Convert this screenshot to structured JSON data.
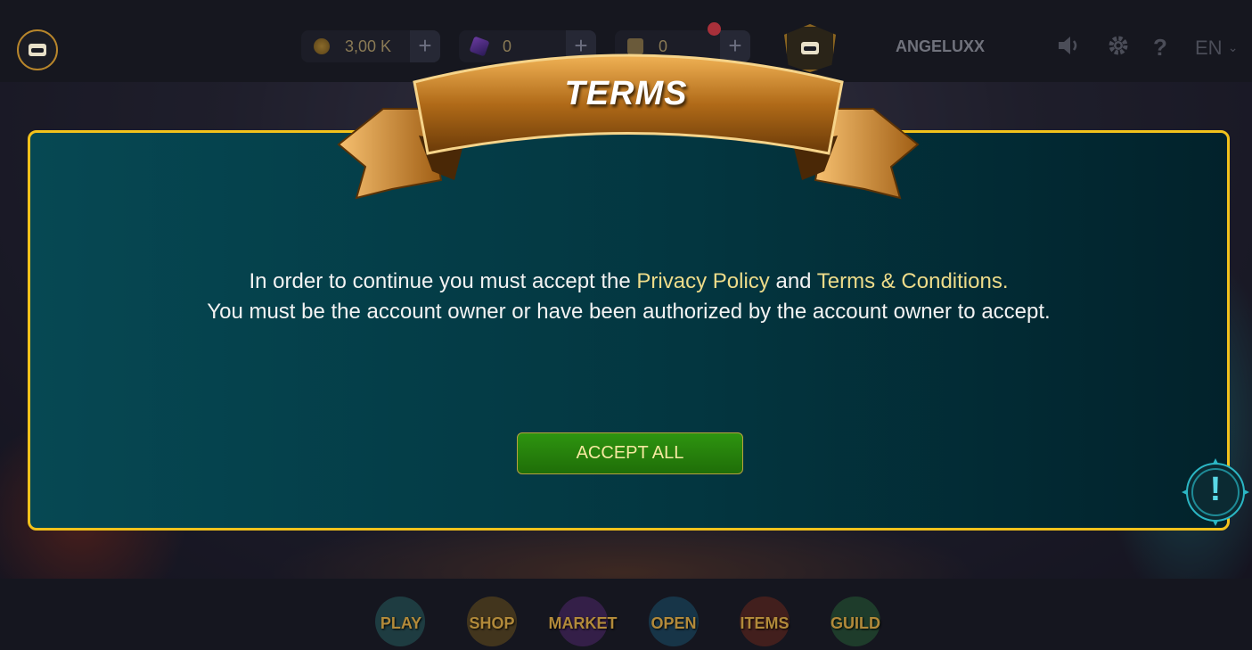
{
  "header": {
    "coins": "3,00 K",
    "gems": "0",
    "scrolls": "0",
    "plus": "+",
    "username": "ANGELUXX",
    "language": "EN",
    "icons": [
      "sound-icon",
      "gear-icon",
      "help-icon",
      "chevron-down-icon"
    ]
  },
  "modal": {
    "title": "TERMS",
    "line1_pre": "In order to continue you must accept the ",
    "privacy_link": "Privacy Policy",
    "and": " and ",
    "terms_link": "Terms & Conditions.",
    "line2": "You must be the account owner or have been authorized by the account owner to accept.",
    "accept_label": "ACCEPT ALL"
  },
  "alert_icon": "!",
  "nav": {
    "items": [
      {
        "label": "PLAY",
        "color": "#2a6a6a"
      },
      {
        "label": "SHOP",
        "color": "#7a5a1a"
      },
      {
        "label": "MARKET",
        "color": "#5a2a7a"
      },
      {
        "label": "OPEN",
        "color": "#1a5a7a"
      },
      {
        "label": "ITEMS",
        "color": "#7a2a1a"
      },
      {
        "label": "GUILD",
        "color": "#2a6a3a"
      }
    ]
  },
  "colors": {
    "modal_border": "#f2c21c",
    "link": "#eedc8a",
    "accept_bg": "#2e9410",
    "accept_text": "#f6e9a0"
  }
}
